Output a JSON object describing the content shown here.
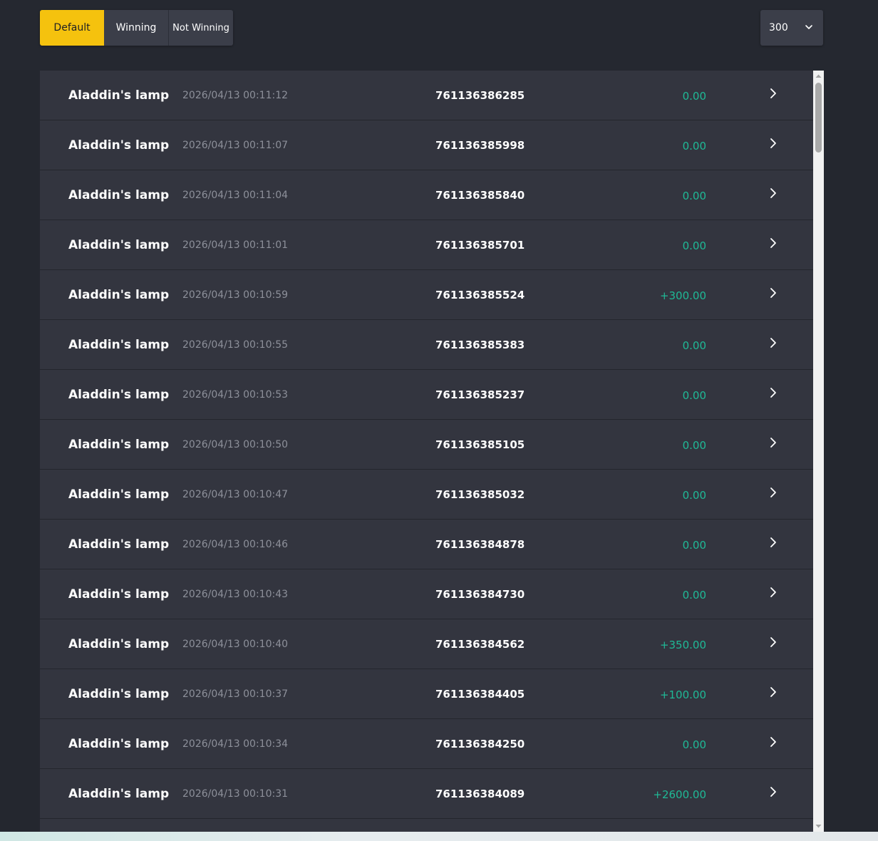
{
  "filters": [
    {
      "label": "Default",
      "active": true
    },
    {
      "label": "Winning",
      "active": false
    },
    {
      "label": "Not Winning",
      "active": false
    }
  ],
  "page_size": {
    "value": "300",
    "icon": "chevron-down-icon"
  },
  "colors": {
    "accent": "#f5c20e",
    "win_amount": "#1fb996",
    "row_bg": "#33353f",
    "page_bg": "#24272f"
  },
  "records": [
    {
      "game": "Aladdin's lamp",
      "time": "2026/04/13 00:11:12",
      "order_id": "761136386285",
      "amount": "0.00"
    },
    {
      "game": "Aladdin's lamp",
      "time": "2026/04/13 00:11:07",
      "order_id": "761136385998",
      "amount": "0.00"
    },
    {
      "game": "Aladdin's lamp",
      "time": "2026/04/13 00:11:04",
      "order_id": "761136385840",
      "amount": "0.00"
    },
    {
      "game": "Aladdin's lamp",
      "time": "2026/04/13 00:11:01",
      "order_id": "761136385701",
      "amount": "0.00"
    },
    {
      "game": "Aladdin's lamp",
      "time": "2026/04/13 00:10:59",
      "order_id": "761136385524",
      "amount": "+300.00"
    },
    {
      "game": "Aladdin's lamp",
      "time": "2026/04/13 00:10:55",
      "order_id": "761136385383",
      "amount": "0.00"
    },
    {
      "game": "Aladdin's lamp",
      "time": "2026/04/13 00:10:53",
      "order_id": "761136385237",
      "amount": "0.00"
    },
    {
      "game": "Aladdin's lamp",
      "time": "2026/04/13 00:10:50",
      "order_id": "761136385105",
      "amount": "0.00"
    },
    {
      "game": "Aladdin's lamp",
      "time": "2026/04/13 00:10:47",
      "order_id": "761136385032",
      "amount": "0.00"
    },
    {
      "game": "Aladdin's lamp",
      "time": "2026/04/13 00:10:46",
      "order_id": "761136384878",
      "amount": "0.00"
    },
    {
      "game": "Aladdin's lamp",
      "time": "2026/04/13 00:10:43",
      "order_id": "761136384730",
      "amount": "0.00"
    },
    {
      "game": "Aladdin's lamp",
      "time": "2026/04/13 00:10:40",
      "order_id": "761136384562",
      "amount": "+350.00"
    },
    {
      "game": "Aladdin's lamp",
      "time": "2026/04/13 00:10:37",
      "order_id": "761136384405",
      "amount": "+100.00"
    },
    {
      "game": "Aladdin's lamp",
      "time": "2026/04/13 00:10:34",
      "order_id": "761136384250",
      "amount": "0.00"
    },
    {
      "game": "Aladdin's lamp",
      "time": "2026/04/13 00:10:31",
      "order_id": "761136384089",
      "amount": "+2600.00"
    },
    {
      "game": "",
      "time": "",
      "order_id": "",
      "amount": ""
    }
  ]
}
